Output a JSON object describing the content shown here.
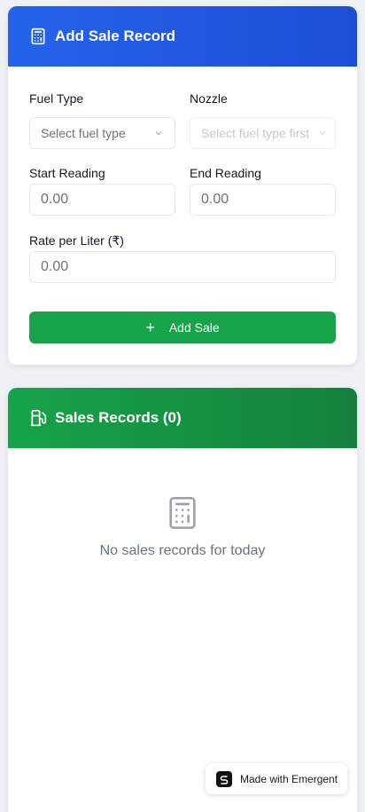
{
  "form": {
    "title": "Add Sale Record",
    "fuel_type_label": "Fuel Type",
    "fuel_type_placeholder": "Select fuel type",
    "nozzle_label": "Nozzle",
    "nozzle_placeholder": "Select fuel type first",
    "start_reading_label": "Start Reading",
    "start_reading_placeholder": "0.00",
    "end_reading_label": "End Reading",
    "end_reading_placeholder": "0.00",
    "rate_label": "Rate per Liter (₹)",
    "rate_placeholder": "0.00",
    "submit_label": "Add Sale",
    "submit_icon": "+"
  },
  "records": {
    "title": "Sales Records (0)",
    "empty_text": "No sales records for today"
  },
  "badge": {
    "label": "Made with Emergent"
  },
  "colors": {
    "primary_blue": "#2563eb",
    "primary_green": "#16a34a"
  },
  "icons": {
    "form_header": "calculator-icon",
    "records_header": "fuel-pump-icon",
    "empty_state": "calculator-icon",
    "select_chevron": "chevron-down-icon"
  }
}
